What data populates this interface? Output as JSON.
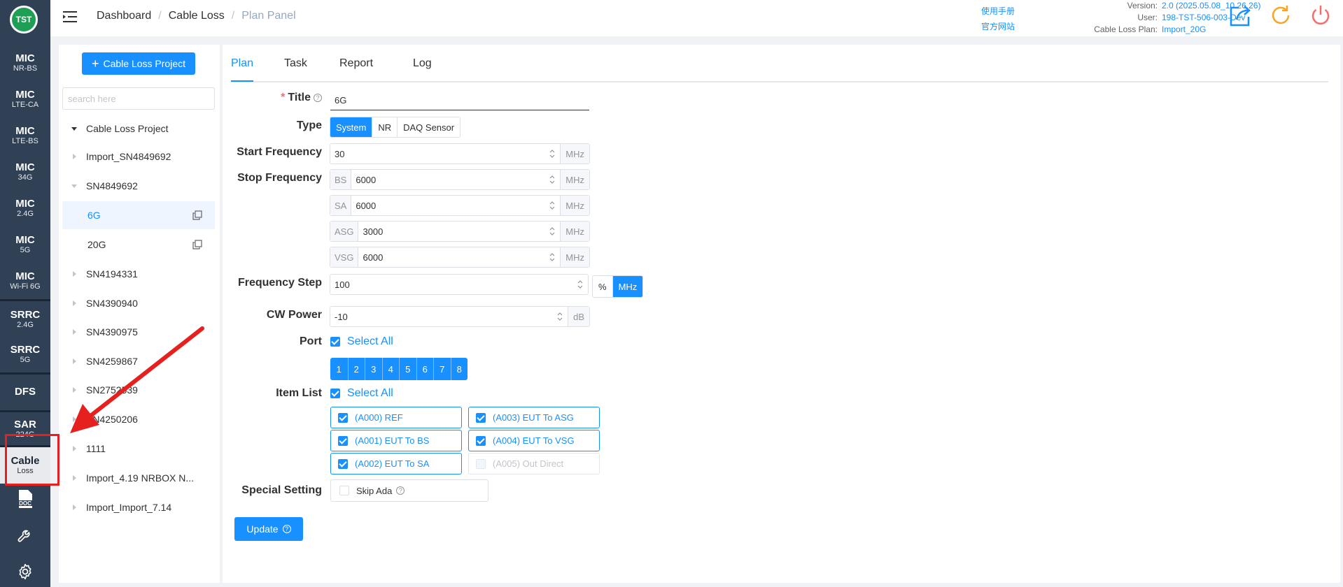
{
  "rail": {
    "logo": "TST",
    "items": [
      {
        "main": "MIC",
        "sub": "NR-BS"
      },
      {
        "main": "MIC",
        "sub": "LTE-CA"
      },
      {
        "main": "MIC",
        "sub": "LTE-BS"
      },
      {
        "main": "MIC",
        "sub": "34G"
      },
      {
        "main": "MIC",
        "sub": "2.4G"
      },
      {
        "main": "MIC",
        "sub": "5G"
      },
      {
        "main": "MIC",
        "sub": "Wi-Fi 6G"
      },
      {
        "main": "SRRC",
        "sub": "2.4G"
      },
      {
        "main": "SRRC",
        "sub": "5G"
      },
      {
        "main": "DFS",
        "sub": ""
      },
      {
        "main": "SAR",
        "sub": "224G"
      },
      {
        "main": "Cable",
        "sub": "Loss"
      }
    ],
    "doc_icon": "doc-icon",
    "tools_icon": "wrench-icon",
    "settings_icon": "gear-icon"
  },
  "header": {
    "breadcrumb": [
      "Dashboard",
      "Cable Loss",
      "Plan Panel"
    ],
    "links": [
      "使用手册",
      "官方网站"
    ],
    "info": [
      {
        "label": "Version:",
        "value": "2.0 (2025.05.08_10.26.26)"
      },
      {
        "label": "User:",
        "value": "198-TST-506-003-Dev"
      },
      {
        "label": "Cable Loss Plan:",
        "value": "Import_20G"
      }
    ],
    "colors": {
      "accent": "#1890ff",
      "refresh": "#f5a623",
      "power": "#f56c6c"
    }
  },
  "tree": {
    "add_label": "Cable Loss Project",
    "search_placeholder": "search here",
    "nodes": [
      {
        "label": "Cable Loss Project",
        "level": 0,
        "expanded": true
      },
      {
        "label": "Import_SN4849692",
        "level": 1
      },
      {
        "label": "SN4849692",
        "level": 1,
        "expanded": true
      },
      {
        "label": "6G",
        "level": 2,
        "selected": true
      },
      {
        "label": "20G",
        "level": 2
      },
      {
        "label": "SN4194331",
        "level": 1
      },
      {
        "label": "SN4390940",
        "level": 1
      },
      {
        "label": "SN4390975",
        "level": 1
      },
      {
        "label": "SN4259867",
        "level": 1
      },
      {
        "label": "SN2752539",
        "level": 1
      },
      {
        "label": "SN4250206",
        "level": 1
      },
      {
        "label": "1111",
        "level": 1
      },
      {
        "label": "Import_4.19 NRBOX N...",
        "level": 1
      },
      {
        "label": "Import_Import_7.14",
        "level": 1
      }
    ]
  },
  "tabs": [
    "Plan",
    "Task",
    "Report",
    "Log"
  ],
  "form": {
    "title_label": "Title",
    "title_value": "6G",
    "type_label": "Type",
    "type_options": [
      "System",
      "NR",
      "DAQ Sensor"
    ],
    "type_selected": "System",
    "start_freq_label": "Start Frequency",
    "start_freq": {
      "value": "30",
      "unit": "MHz"
    },
    "stop_freq_label": "Stop Frequency",
    "stop_freq": [
      {
        "prefix": "BS",
        "value": "6000",
        "unit": "MHz"
      },
      {
        "prefix": "SA",
        "value": "6000",
        "unit": "MHz"
      },
      {
        "prefix": "ASG",
        "value": "3000",
        "unit": "MHz"
      },
      {
        "prefix": "VSG",
        "value": "6000",
        "unit": "MHz"
      }
    ],
    "freq_step_label": "Frequency Step",
    "freq_step": {
      "value": "100",
      "units": [
        "%",
        "MHz"
      ],
      "selected_unit": "MHz"
    },
    "cw_power_label": "CW Power",
    "cw_power": {
      "value": "-10",
      "unit": "dB"
    },
    "port_label": "Port",
    "select_all": "Select All",
    "ports": [
      "1",
      "2",
      "3",
      "4",
      "5",
      "6",
      "7",
      "8"
    ],
    "item_list_label": "Item List",
    "items": [
      {
        "label": "(A000) REF",
        "checked": true
      },
      {
        "label": "(A003) EUT To ASG",
        "checked": true
      },
      {
        "label": "(A001) EUT To BS",
        "checked": true
      },
      {
        "label": "(A004) EUT To VSG",
        "checked": true
      },
      {
        "label": "(A002) EUT To SA",
        "checked": true
      },
      {
        "label": "(A005) Out Direct",
        "checked": false,
        "disabled": true
      }
    ],
    "special_label": "Special Setting",
    "skip_ada": "Skip Ada",
    "update_label": "Update"
  }
}
